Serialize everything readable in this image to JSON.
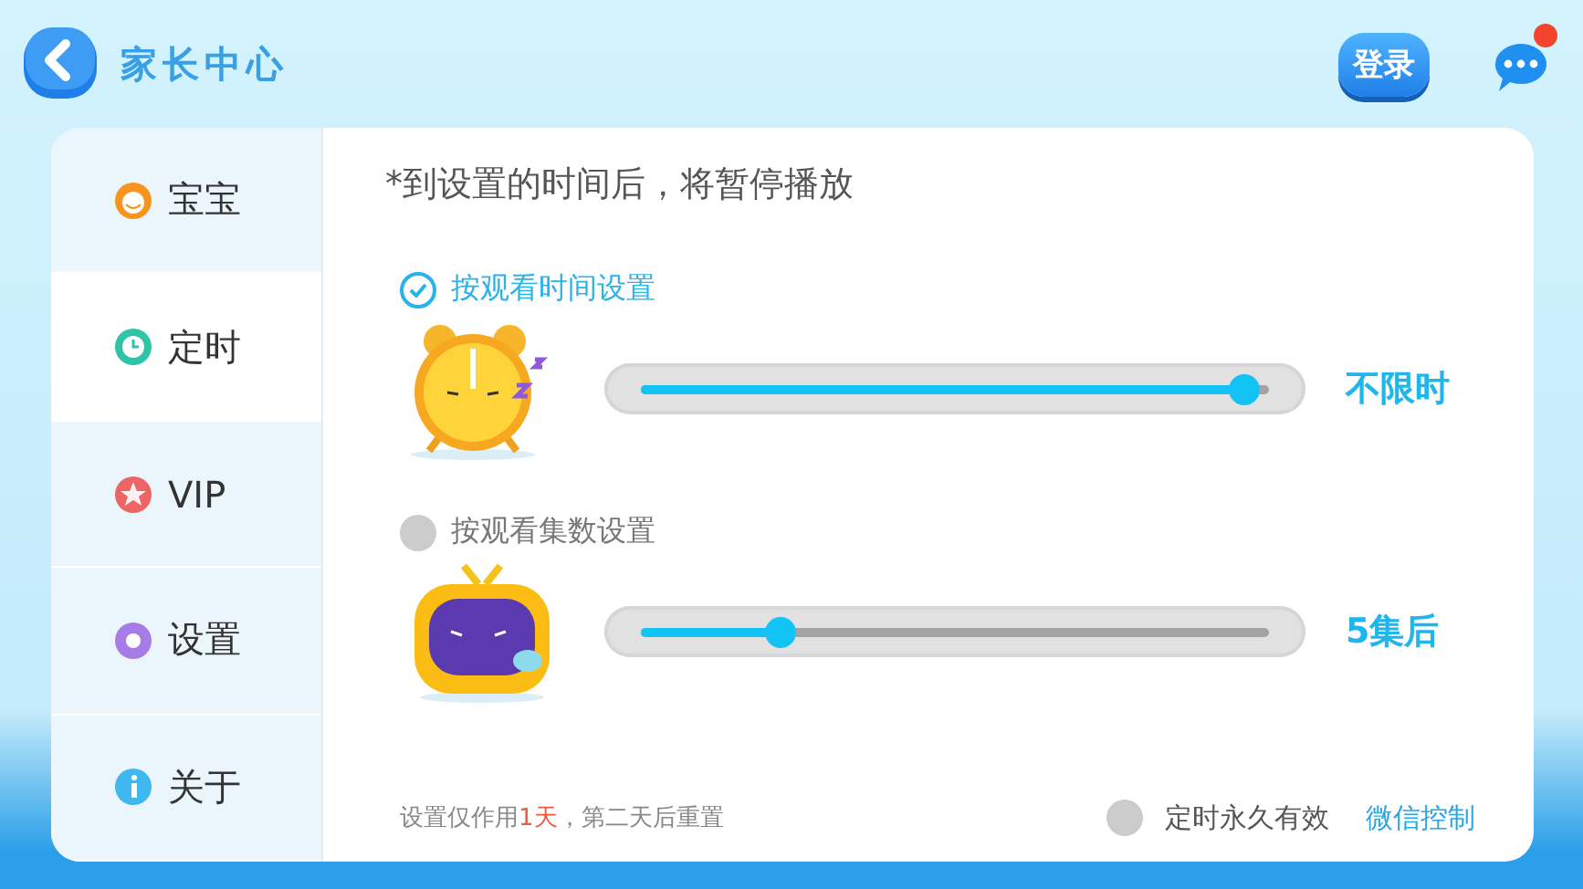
{
  "header": {
    "title": "家长中心",
    "login_button": "登录",
    "has_unread": true
  },
  "sidebar": {
    "items": [
      {
        "label": "宝宝",
        "kind": "face",
        "selected": false
      },
      {
        "label": "定时",
        "kind": "alarm",
        "selected": true
      },
      {
        "label": "VIP",
        "kind": "star",
        "selected": false
      },
      {
        "label": "设置",
        "kind": "gear",
        "selected": false
      },
      {
        "label": "关于",
        "kind": "info",
        "selected": false
      }
    ]
  },
  "notice": "*到设置的时间后，将暂停播放",
  "options": [
    {
      "label": "按观看时间设置",
      "kind": "clock",
      "selected": true,
      "level": 0.96,
      "reading": "不限时"
    },
    {
      "label": "按观看集数设置",
      "kind": "tv",
      "selected": false,
      "level": 0.22,
      "reading": "5集后"
    }
  ],
  "footer": {
    "note_before": "设置仅作用",
    "note_highlight": "1天",
    "note_after": "，第二天后重置",
    "permanent": {
      "label": "定时永久有效",
      "checked": false
    },
    "link": "微信控制"
  }
}
